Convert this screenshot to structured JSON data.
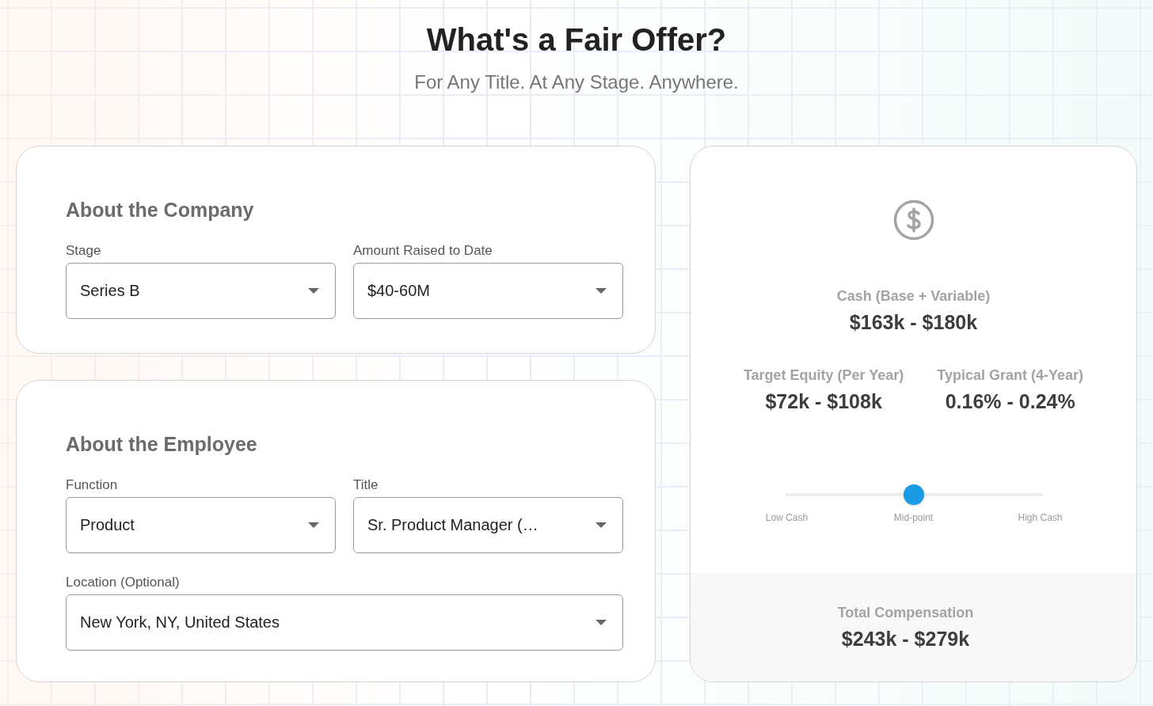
{
  "header": {
    "title": "What's a Fair Offer?",
    "subtitle": "For Any Title. At Any Stage. Anywhere."
  },
  "sections": [
    {
      "heading": "About the Company",
      "fields": [
        {
          "label": "Stage",
          "value": "Series B",
          "wide": false
        },
        {
          "label": "Amount Raised to Date",
          "value": "$40-60M",
          "wide": false
        }
      ]
    },
    {
      "heading": "About the Employee",
      "fields": [
        {
          "label": "Function",
          "value": "Product",
          "wide": false
        },
        {
          "label": "Title",
          "value": "Sr. Product Manager (…",
          "wide": false
        },
        {
          "label": "Location (Optional)",
          "value": "New York, NY, United States",
          "wide": true
        }
      ]
    }
  ],
  "results": {
    "cash": {
      "label": "Cash (Base + Variable)",
      "value": "$163k - $180k"
    },
    "metrics": [
      {
        "label": "Target Equity (Per Year)",
        "value": "$72k - $108k"
      },
      {
        "label": "Typical Grant (4-Year)",
        "value": "0.16% - 0.24%"
      }
    ],
    "slider": {
      "level": 0.5,
      "labels": [
        "Low Cash",
        "Mid-point",
        "High Cash"
      ]
    },
    "total": {
      "label": "Total Compensation",
      "value": "$243k - $279k"
    }
  }
}
